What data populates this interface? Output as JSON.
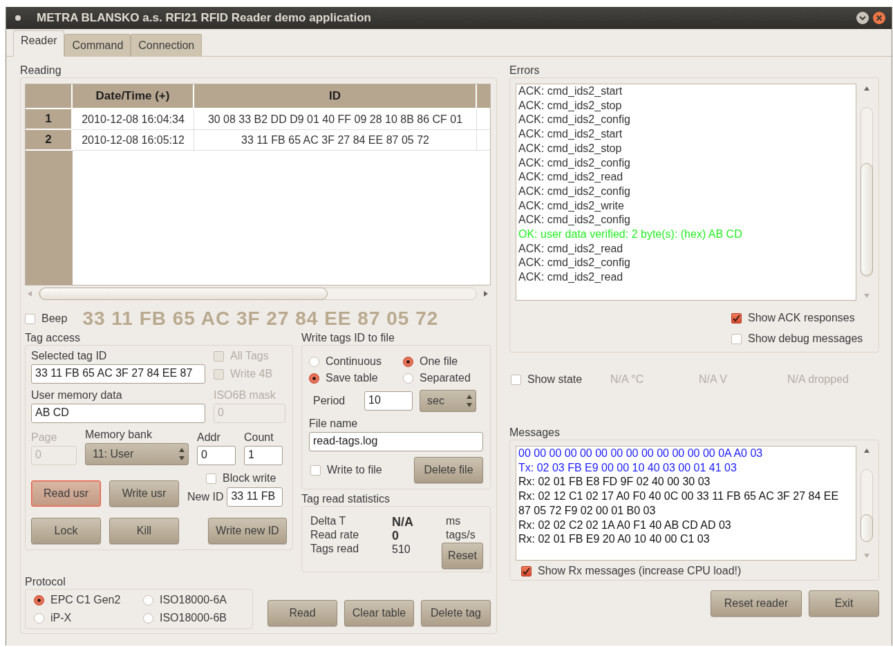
{
  "window": {
    "title": "METRA BLANSKO a.s. RFI21 RFID Reader demo application"
  },
  "tabs": [
    {
      "label": "Reader",
      "selected": true
    },
    {
      "label": "Command",
      "selected": false
    },
    {
      "label": "Connection",
      "selected": false
    }
  ],
  "reading": {
    "title": "Reading",
    "table": {
      "columns": [
        "Date/Time (+)",
        "ID"
      ],
      "rows": [
        {
          "number": "1",
          "cells": [
            "2010-12-08 16:04:34",
            "30 08 33 B2 DD D9 01 40 FF 09 28 10 8B 86 CF 01"
          ]
        },
        {
          "number": "2",
          "cells": [
            "2010-12-08 16:05:12",
            "33 11 FB 65 AC 3F 27 84 EE 87 05 72"
          ]
        }
      ]
    },
    "beep": {
      "label": "Beep",
      "checked": false
    },
    "last_tag_id": "33 11 FB 65 AC 3F 27 84 EE 87 05 72"
  },
  "tag_access": {
    "title": "Tag access",
    "selected_tag_id": {
      "label": "Selected tag ID",
      "value": "33 11 FB 65 AC 3F 27 84 EE 87"
    },
    "options": [
      {
        "label": "All Tags",
        "checked": false,
        "disabled": true
      },
      {
        "label": "Write 4B",
        "checked": false,
        "disabled": true
      }
    ],
    "user_memory": {
      "label": "User memory data",
      "value": "AB CD"
    },
    "iso6b_mask": {
      "label": "ISO6B mask",
      "value": "0",
      "disabled": true
    },
    "page": {
      "label": "Page",
      "value": "0",
      "disabled": true
    },
    "memory_bank": {
      "label": "Memory bank",
      "value": "11: User"
    },
    "addr": {
      "label": "Addr",
      "value": "0"
    },
    "count": {
      "label": "Count",
      "value": "1"
    },
    "block_write": {
      "label": "Block write",
      "checked": false
    },
    "new_id": {
      "label": "New ID",
      "value": "33 11 FB"
    },
    "buttons": [
      {
        "label": "Read usr",
        "focused": true
      },
      {
        "label": "Write usr",
        "focused": false
      },
      {
        "label": "Lock",
        "focused": false
      },
      {
        "label": "Kill",
        "focused": false
      },
      {
        "label": "Write new ID",
        "focused": false
      }
    ]
  },
  "write_file": {
    "title": "Write tags ID to file",
    "mode": [
      {
        "label": "Continuous",
        "selected": false
      },
      {
        "label": "Save table",
        "selected": true
      }
    ],
    "files": [
      {
        "label": "One file",
        "selected": true
      },
      {
        "label": "Separated",
        "selected": false
      }
    ],
    "period": {
      "label": "Period",
      "value": "10",
      "unit": "sec"
    },
    "file_name": {
      "label": "File name",
      "value": "read-tags.log"
    },
    "write_to_file": {
      "label": "Write to file",
      "checked": false
    },
    "delete_button": "Delete file"
  },
  "statistics": {
    "title": "Tag read statistics",
    "rows": [
      {
        "label": "Delta T",
        "value": "N/A",
        "unit": "ms",
        "bold": true
      },
      {
        "label": "Read rate",
        "value": "0",
        "unit": "tags/s",
        "bold": true
      },
      {
        "label": "Tags read",
        "value": "510",
        "bold": false
      }
    ],
    "reset_button": "Reset"
  },
  "protocol": {
    "title": "Protocol",
    "options": [
      {
        "label": "EPC C1 Gen2",
        "selected": true
      },
      {
        "label": "ISO18000-6A",
        "selected": false
      },
      {
        "label": "iP-X",
        "selected": false
      },
      {
        "label": "ISO18000-6B",
        "selected": false
      }
    ]
  },
  "actions": [
    "Read",
    "Clear table",
    "Delete tag"
  ],
  "errors": {
    "title": "Errors",
    "lines": [
      {
        "text": "ACK: cmd_ids2_start",
        "kind": "ack"
      },
      {
        "text": "ACK: cmd_ids2_stop",
        "kind": "ack"
      },
      {
        "text": "ACK: cmd_ids2_config",
        "kind": "ack"
      },
      {
        "text": "ACK: cmd_ids2_start",
        "kind": "ack"
      },
      {
        "text": "ACK: cmd_ids2_stop",
        "kind": "ack"
      },
      {
        "text": "ACK: cmd_ids2_config",
        "kind": "ack"
      },
      {
        "text": "ACK: cmd_ids2_read",
        "kind": "ack"
      },
      {
        "text": "ACK: cmd_ids2_config",
        "kind": "ack"
      },
      {
        "text": "ACK: cmd_ids2_write",
        "kind": "ack"
      },
      {
        "text": "ACK: cmd_ids2_config",
        "kind": "ack"
      },
      {
        "text": "OK: user data verified: 2 byte(s): (hex) AB CD",
        "kind": "ok"
      },
      {
        "text": "ACK: cmd_ids2_read",
        "kind": "ack"
      },
      {
        "text": "ACK: cmd_ids2_config",
        "kind": "ack"
      },
      {
        "text": "ACK: cmd_ids2_read",
        "kind": "ack"
      }
    ],
    "options": [
      {
        "label": "Show ACK responses",
        "checked": true
      },
      {
        "label": "Show debug messages",
        "checked": false
      }
    ]
  },
  "state": {
    "show_state": {
      "label": "Show state",
      "checked": false
    },
    "readings": [
      "N/A °C",
      "N/A V",
      "N/A dropped"
    ]
  },
  "messages": {
    "title": "Messages",
    "lines": [
      {
        "text": "00 00 00 00 00 00 00 00 00 00 00 00 00 0A A0 03",
        "kind": "tx"
      },
      {
        "text": "Tx: 02 03 FB E9 00 00 10 40 03 00 01 41 03",
        "kind": "tx"
      },
      {
        "text": "Rx: 02 01 FB E8 FD 9F 02 40 00 30 03",
        "kind": "rx"
      },
      {
        "text": "Rx: 02 12 C1 02 17 A0 F0 40 0C 00 33 11 FB 65 AC 3F 27 84 EE 87 05 72 F9 02 00 01 B0 03",
        "kind": "rx"
      },
      {
        "text": "Rx: 02 02 C2 02 1A A0 F1 40 AB CD AD 03",
        "kind": "rx"
      },
      {
        "text": "Rx: 02 01 FB E9 20 A0 10 40 00 C1 03",
        "kind": "rx"
      }
    ],
    "show_rx": {
      "label": "Show Rx messages (increase CPU load!)",
      "checked": true
    }
  },
  "footer_buttons": [
    "Reset reader",
    "Exit"
  ]
}
